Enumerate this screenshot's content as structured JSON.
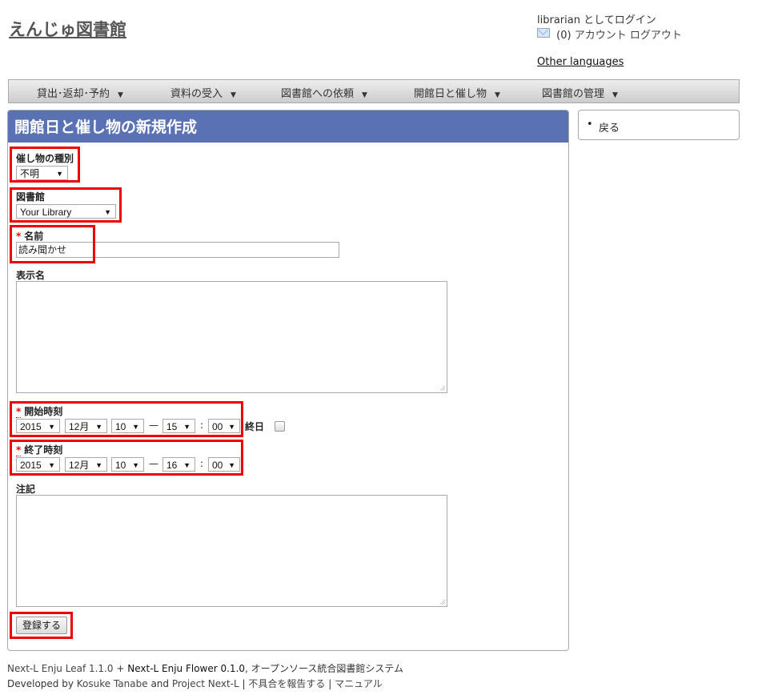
{
  "header": {
    "site_title": "えんじゅ図書館",
    "login_status": "librarian としてログイン",
    "message_count": "(0)",
    "account_link": "アカウント",
    "logout_link": "ログアウト",
    "other_languages": "Other languages"
  },
  "nav": {
    "items": [
      {
        "label": "貸出･返却･予約"
      },
      {
        "label": "資料の受入"
      },
      {
        "label": "図書館への依頼"
      },
      {
        "label": "開館日と催し物"
      },
      {
        "label": "図書館の管理"
      }
    ],
    "caret": "▼"
  },
  "page": {
    "title": "開館日と催し物の新規作成"
  },
  "sidebar": {
    "bullet": "•",
    "back_link": "戻る"
  },
  "form": {
    "required_mark": "*",
    "event_category": {
      "label": "催し物の種別",
      "value": "不明"
    },
    "library": {
      "label": "図書館",
      "value": "Your Library"
    },
    "name": {
      "label": "名前",
      "value": "読み聞かせ"
    },
    "display_name": {
      "label": "表示名",
      "value": ""
    },
    "start_at": {
      "label": "開始時刻",
      "year": "2015",
      "month": "12月",
      "day": "10",
      "hour": "15",
      "minute": "00"
    },
    "all_day": {
      "label": "終日",
      "checked": false
    },
    "end_at": {
      "label": "終了時刻",
      "year": "2015",
      "month": "12月",
      "day": "10",
      "hour": "16",
      "minute": "00"
    },
    "note": {
      "label": "注記",
      "value": ""
    },
    "dash": "—",
    "colon": ":",
    "submit_label": "登録する"
  },
  "footer": {
    "leaf_link": "Next-L Enju Leaf 1.1.0",
    "plus": "+",
    "flower_link": "Next-L Enju Flower 0.1.0",
    "tagline": ", オープンソース統合図書館システム",
    "developed_by": "Developed by",
    "author_link": "Kosuke Tanabe",
    "and": "and",
    "project_link": "Project Next-L",
    "pipe": "|",
    "report_link": "不具合を報告する",
    "manual_link": "マニュアル"
  }
}
